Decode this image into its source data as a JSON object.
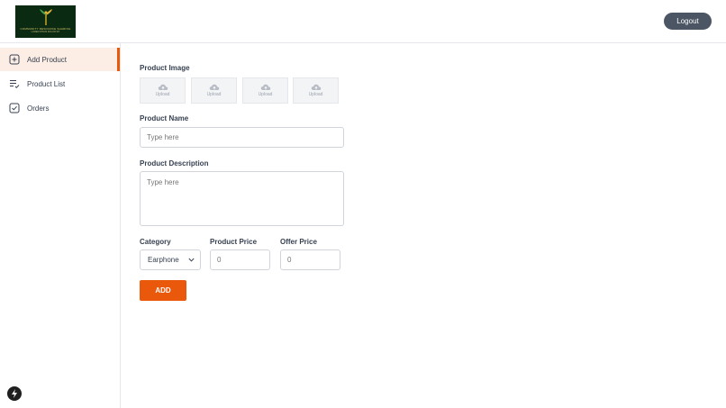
{
  "header": {
    "logo_text": "COMMUNITY RESOURCE SHARING",
    "logo_subtext": "LOREM IPSUM DOLOR SIT",
    "logout_label": "Logout"
  },
  "sidebar": {
    "items": [
      {
        "label": "Add Product",
        "icon": "add-square-icon",
        "active": true
      },
      {
        "label": "Product List",
        "icon": "list-check-icon",
        "active": false
      },
      {
        "label": "Orders",
        "icon": "checkbox-icon",
        "active": false
      }
    ]
  },
  "form": {
    "image_label": "Product Image",
    "upload_slots": [
      "Upload",
      "Upload",
      "Upload",
      "Upload"
    ],
    "name_label": "Product Name",
    "name_placeholder": "Type here",
    "description_label": "Product Description",
    "description_placeholder": "Type here",
    "category_label": "Category",
    "category_value": "Earphone",
    "price_label": "Product Price",
    "price_placeholder": "0",
    "offer_label": "Offer Price",
    "offer_placeholder": "0",
    "add_label": "ADD"
  },
  "colors": {
    "accent": "#ea580c",
    "active_bg": "#fdeee5",
    "logout_bg": "#4b5563"
  }
}
